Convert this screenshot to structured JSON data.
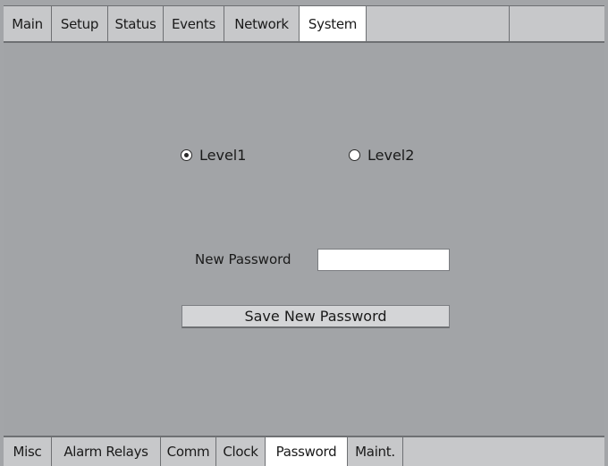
{
  "top_tabs": [
    {
      "label": "Main"
    },
    {
      "label": "Setup"
    },
    {
      "label": "Status"
    },
    {
      "label": "Events"
    },
    {
      "label": "Network"
    },
    {
      "label": "System",
      "active": true
    }
  ],
  "main": {
    "radio_level1_label": "Level1",
    "radio_level1_checked": true,
    "radio_level2_label": "Level2",
    "radio_level2_checked": false,
    "password_label": "New Password",
    "password_value": "",
    "save_button_label": "Save New Password"
  },
  "bottom_tabs": [
    {
      "label": "Misc"
    },
    {
      "label": "Alarm Relays"
    },
    {
      "label": "Comm"
    },
    {
      "label": "Clock"
    },
    {
      "label": "Password",
      "active": true
    },
    {
      "label": "Maint."
    }
  ],
  "colors": {
    "panel_bg": "#a2a4a7",
    "tab_bg": "#c7c8ca",
    "active_tab_bg": "#ffffff",
    "button_bg": "#d4d5d7"
  }
}
